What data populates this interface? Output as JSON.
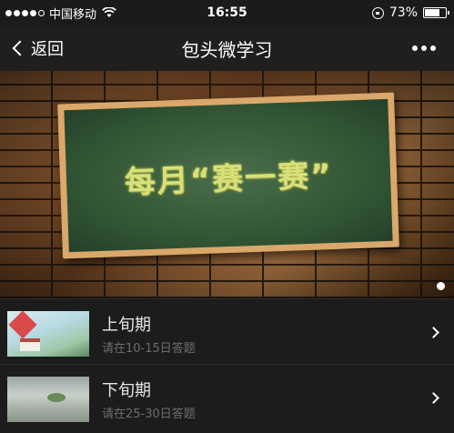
{
  "status_bar": {
    "carrier": "中国移动",
    "time": "16:55",
    "battery": "73%",
    "battery_level": 0.73
  },
  "nav": {
    "back_label": "返回",
    "title": "包头微学习"
  },
  "banner": {
    "headline": "每月“赛一赛”"
  },
  "list": [
    {
      "title": "上旬期",
      "subtitle": "请在10-15日答题"
    },
    {
      "title": "下旬期",
      "subtitle": "请在25-30日答题"
    }
  ]
}
